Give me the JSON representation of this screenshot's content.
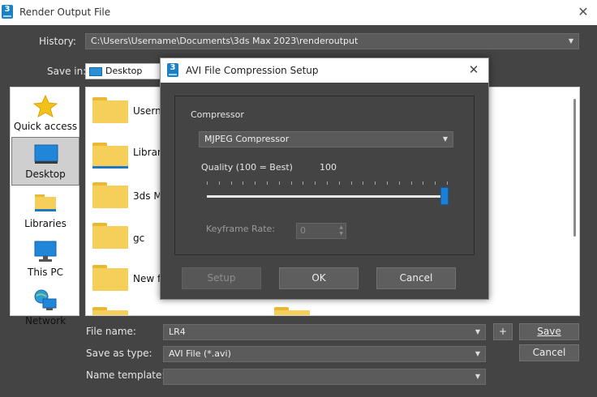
{
  "window": {
    "title": "Render Output File",
    "app_icon": "3",
    "close_glyph": "✕"
  },
  "history": {
    "label": "History:",
    "value": "C:\\Users\\Username\\Documents\\3ds Max 2023\\renderoutput"
  },
  "save_in": {
    "label": "Save in:",
    "value": "Desktop"
  },
  "places": [
    {
      "label": "Quick access",
      "icon": "star-icon"
    },
    {
      "label": "Desktop",
      "icon": "desktop-icon",
      "selected": true
    },
    {
      "label": "Libraries",
      "icon": "libraries-icon"
    },
    {
      "label": "This PC",
      "icon": "computer-icon"
    },
    {
      "label": "Network",
      "icon": "network-icon"
    }
  ],
  "files": [
    {
      "name": "Userna"
    },
    {
      "name": "Librari"
    },
    {
      "name": "3ds M"
    },
    {
      "name": "gc"
    },
    {
      "name": "New fo"
    },
    {
      "name": ""
    }
  ],
  "file_name": {
    "label": "File name:",
    "value": "LR4"
  },
  "save_as_type": {
    "label": "Save as type:",
    "value": "AVI File (*.avi)"
  },
  "name_template": {
    "label": "Name template:",
    "value": ""
  },
  "buttons": {
    "plus": "+",
    "save": "Save",
    "cancel": "Cancel"
  },
  "dialog": {
    "title": "AVI File Compression Setup",
    "app_icon": "3",
    "close_glyph": "✕",
    "compressor_label": "Compressor",
    "compressor_value": "MJPEG Compressor",
    "quality_label": "Quality (100 = Best)",
    "quality_value": "100",
    "quality_fraction": 1.0,
    "keyframe_label": "Keyframe Rate:",
    "keyframe_value": "0",
    "setup_button": "Setup",
    "ok_button": "OK",
    "cancel_button": "Cancel"
  },
  "colors": {
    "accent": "#1b7fd6",
    "folder": "#f6cf5b",
    "dialog_bg": "#444444"
  }
}
